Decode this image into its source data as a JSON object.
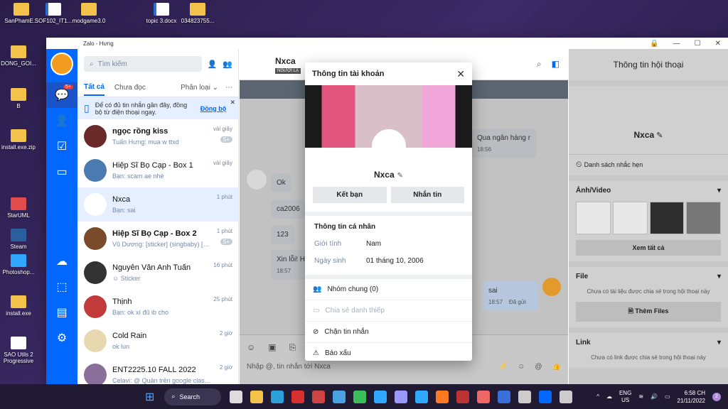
{
  "desktop": {
    "icons": [
      {
        "label": "SanPhamE..."
      },
      {
        "label": "SOF102_IT1..."
      },
      {
        "label": "modgame3.0"
      },
      {
        "label": "topic 3.docx"
      },
      {
        "label": "034823755..."
      },
      {
        "label": "DONG_GOI..."
      },
      {
        "label": "B"
      },
      {
        "label": "install.exe.zip"
      },
      {
        "label": "StarUML"
      },
      {
        "label": "Steam"
      },
      {
        "label": "Photoshop..."
      },
      {
        "label": "install.exe"
      },
      {
        "label": "SAO Utils 2 Progressive"
      }
    ]
  },
  "window": {
    "title": "Zalo - Hưng"
  },
  "list": {
    "search_placeholder": "Tìm kiếm",
    "tabs": {
      "all": "Tất cả",
      "unread": "Chưa đọc",
      "classify": "Phân loại"
    },
    "notice": {
      "text": "Để có đủ tin nhắn gần đây, đồng bộ từ điện thoại ngay.",
      "link": "Đồng bộ"
    },
    "conversations": [
      {
        "name": "ngọc rồng kiss",
        "message": "Tuấn Hưng: mua w ttxd",
        "time": "vài giây",
        "count": "5+"
      },
      {
        "name": "Hiệp Sĩ Bọ Cạp - Box 1",
        "message": "Bạn: scam ae nhé",
        "time": "vài giây",
        "count": ""
      },
      {
        "name": "Nxca",
        "message": "Bạn: sai",
        "time": "1 phút",
        "count": ""
      },
      {
        "name": "Hiệp Sĩ Bọ Cạp - Box 2",
        "message": "Vũ Dương: [sticker] (singbaby) [sticker] Ban...",
        "time": "1 phút",
        "count": "5+"
      },
      {
        "name": "Nguyễn Văn Anh Tuấn",
        "message": "Sticker",
        "time": "16 phút",
        "count": ""
      },
      {
        "name": "Thịnh",
        "message": "Bạn: ok xí đũ ib cho",
        "time": "25 phút",
        "count": ""
      },
      {
        "name": "Cold Rain",
        "message": "ok lun",
        "time": "2 giờ",
        "count": ""
      },
      {
        "name": "ENT2225.10 FALL 2022",
        "message": "Celavi: @ Quân trên google classro...",
        "time": "2 giờ",
        "count": ""
      }
    ]
  },
  "nav": {
    "chat_badge": "5+"
  },
  "chat": {
    "name": "Nxca",
    "tag": "NGƯỜI LẠ",
    "bubbles": [
      {
        "text": "Qua ngân hàng r",
        "time": "18:56"
      },
      {
        "text": "Ok",
        "time": ""
      },
      {
        "text": "ca2006",
        "time": ""
      },
      {
        "text": "123",
        "time": ""
      },
      {
        "text": "Xin lỗi! H",
        "time": "18:57"
      },
      {
        "text": "sai",
        "time": "18:57",
        "status": "Đã gửi"
      }
    ],
    "input_placeholder": "Nhập @, tin nhắn tới Nxca"
  },
  "info": {
    "title": "Thông tin hội thoại",
    "name": "Nxca",
    "reminder": "Danh sách nhắc hẹn",
    "media_title": "Ảnh/Video",
    "view_all": "Xem tất cả",
    "file_title": "File",
    "file_empty": "Chưa có tài liệu được chia sẻ trong hội thoại này",
    "add_files": "Thêm Files",
    "link_title": "Link",
    "link_empty": "Chưa có link được chia sẻ trong hội thoại này"
  },
  "modal": {
    "title": "Thông tin tài khoản",
    "name": "Nxca",
    "add_friend": "Kết bạn",
    "message": "Nhắn tin",
    "personal_title": "Thông tin cá nhân",
    "gender_label": "Giới tính",
    "gender_value": "Nam",
    "birthday_label": "Ngày sinh",
    "birthday_value": "01 tháng 10, 2006",
    "options": {
      "groups": "Nhóm chung (0)",
      "share": "Chia sẻ danh thiếp",
      "block": "Chặn tin nhắn",
      "report": "Báo xấu"
    }
  },
  "taskbar": {
    "search": "Search",
    "lang": "ENG",
    "region": "US",
    "time": "6:58 CH",
    "date": "21/11/2022",
    "notif": "2"
  },
  "colors": {
    "accent": "#0068ff",
    "nav": "#0068ff"
  }
}
